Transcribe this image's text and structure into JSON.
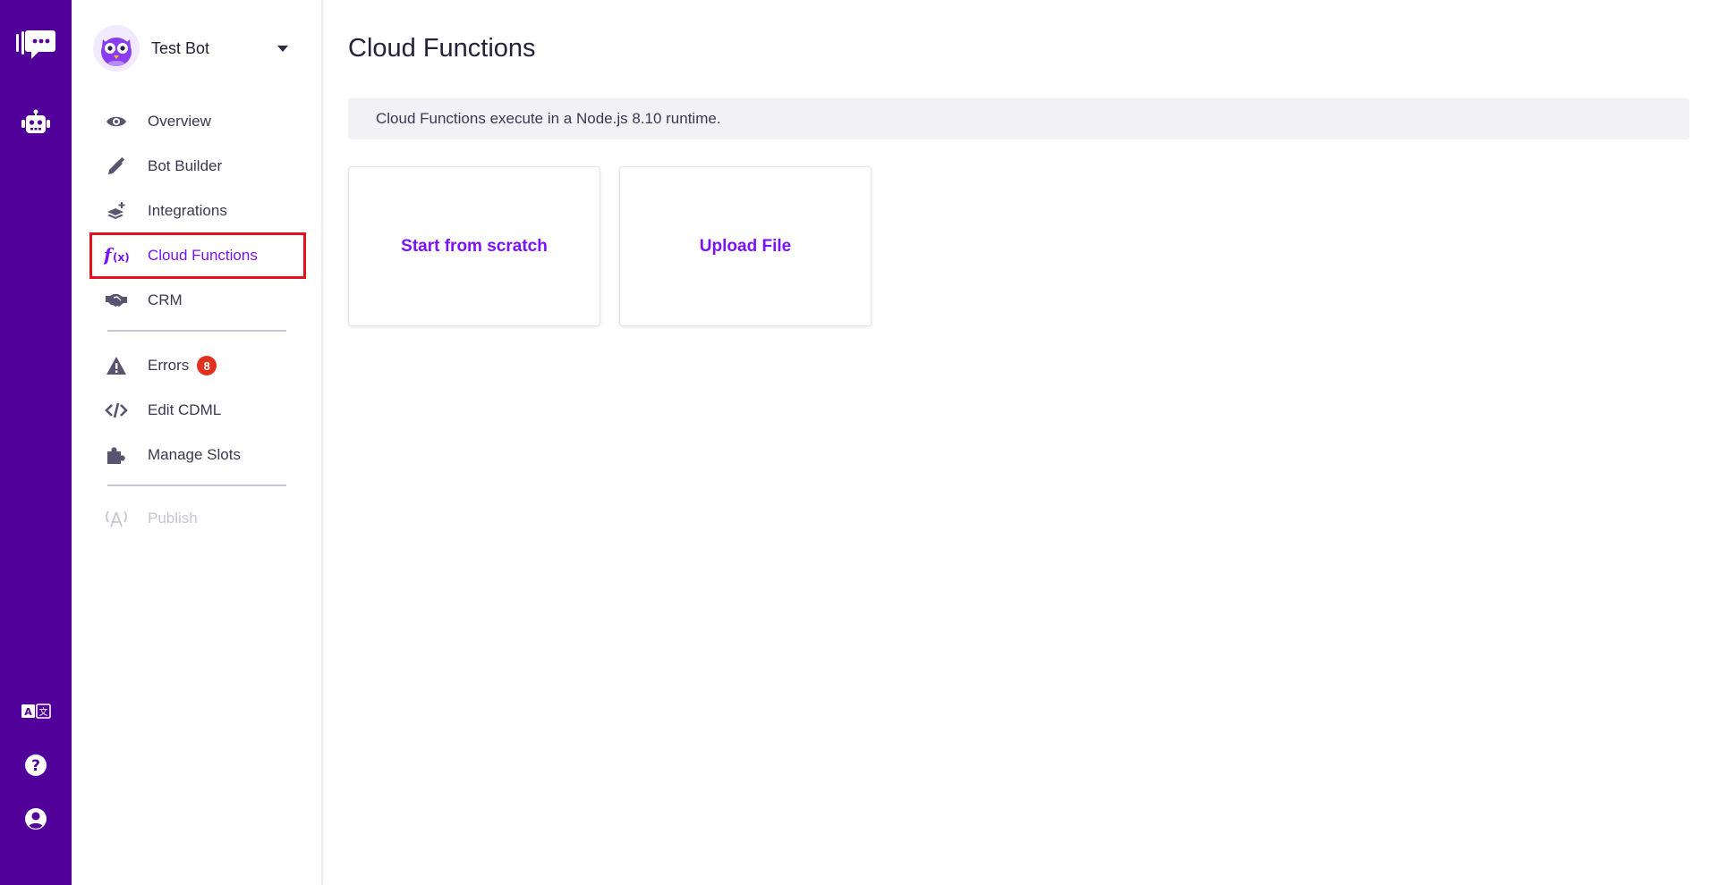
{
  "rail": {
    "top_icons": [
      "chat-logo-icon",
      "robot-icon"
    ],
    "bottom_icons": [
      "translate-icon",
      "help-icon",
      "account-icon"
    ]
  },
  "sidebar": {
    "bot_name": "Test Bot",
    "items": [
      {
        "label": "Overview",
        "icon": "eye-icon"
      },
      {
        "label": "Bot Builder",
        "icon": "pencil-icon"
      },
      {
        "label": "Integrations",
        "icon": "layers-plus-icon"
      },
      {
        "label": "Cloud Functions",
        "icon": "function-icon",
        "active": true
      },
      {
        "label": "CRM",
        "icon": "handshake-icon"
      },
      {
        "label": "Errors",
        "icon": "warning-icon",
        "badge": "8"
      },
      {
        "label": "Edit CDML",
        "icon": "code-icon"
      },
      {
        "label": "Manage Slots",
        "icon": "puzzle-icon"
      },
      {
        "label": "Publish",
        "icon": "broadcast-icon",
        "disabled": true
      }
    ]
  },
  "main": {
    "title": "Cloud Functions",
    "info": "Cloud Functions execute in a Node.js 8.10 runtime.",
    "cards": [
      {
        "label": "Start from scratch"
      },
      {
        "label": "Upload File"
      }
    ]
  },
  "colors": {
    "rail_bg": "#52009a",
    "accent": "#7a12ff",
    "highlight_border": "#e4111f",
    "badge": "#e0301e"
  }
}
